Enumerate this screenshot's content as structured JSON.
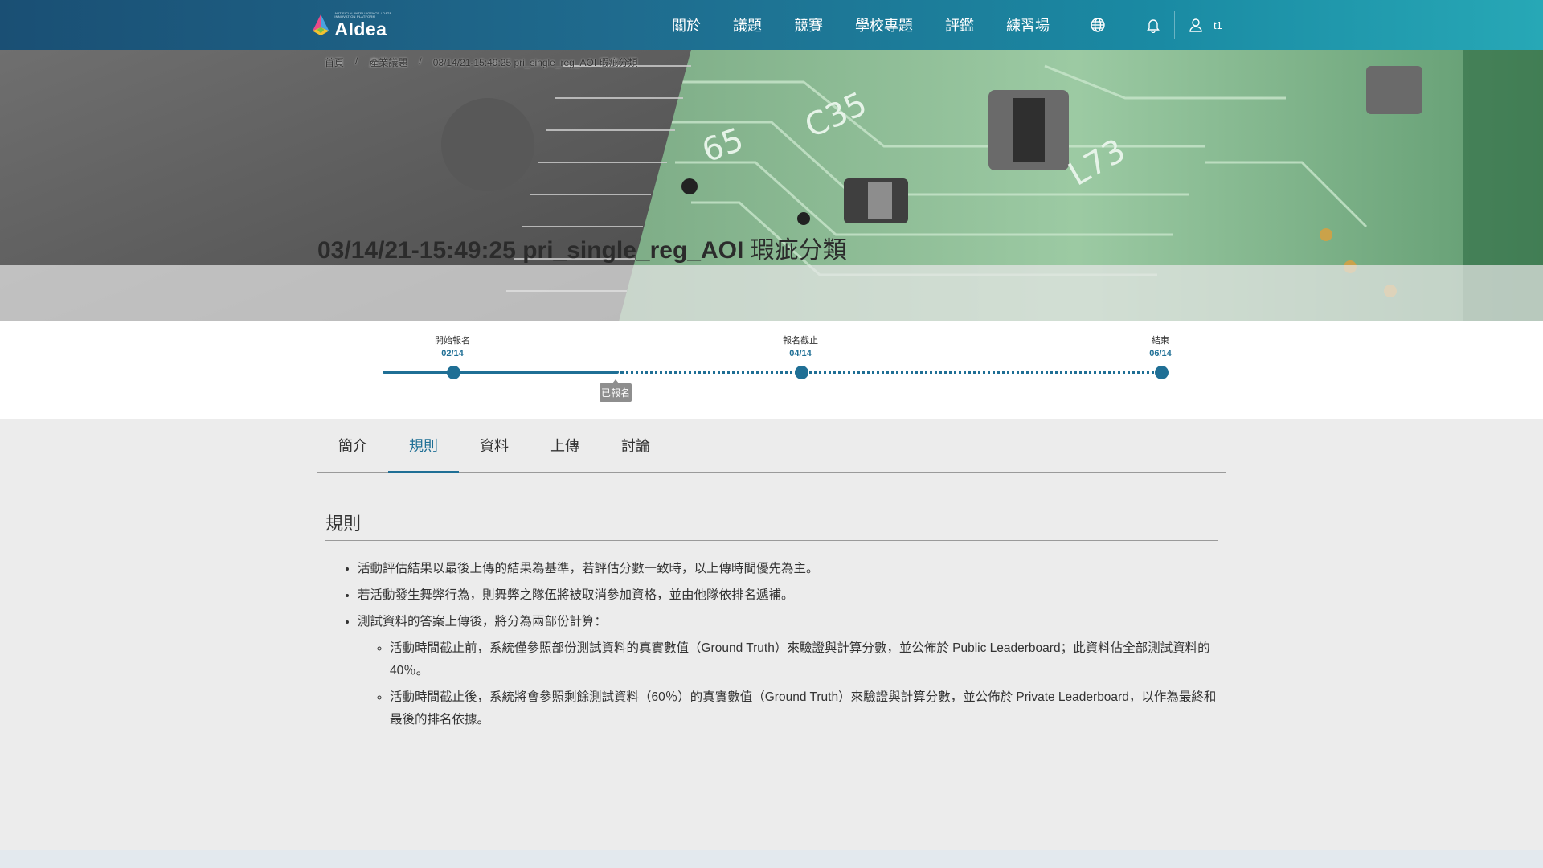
{
  "header": {
    "logo_tagline": "ARTIFICIAL INTELLIGENCE / DATA INNOVATION PLATFORM",
    "logo_text": "AIdea",
    "nav": [
      "關於",
      "議題",
      "競賽",
      "學校專題",
      "評鑑",
      "練習場"
    ],
    "icons": [
      "globe-icon",
      "bell-icon",
      "user-icon"
    ],
    "user_name": "t1",
    "colors": {
      "start": "#1a4f74",
      "end": "#27a8b6"
    }
  },
  "breadcrumb": [
    "首頁",
    "產業議題",
    "03/14/21-15:49:25 pri_single_reg_AOI 瑕疵分類"
  ],
  "page_title": {
    "bold": "03/14/21-15:49:25 pri_single_reg_AOI",
    "rest": " 瑕疵分類"
  },
  "timeline": {
    "milestones": [
      {
        "label": "開始報名",
        "date": "02/14"
      },
      {
        "label": "報名截止",
        "date": "04/14"
      },
      {
        "label": "結束",
        "date": "06/14"
      }
    ],
    "status_badge": "已報名",
    "accent": "#1f6f95"
  },
  "tabs": {
    "items": [
      "簡介",
      "規則",
      "資料",
      "上傳",
      "討論"
    ],
    "active": "規則"
  },
  "rules": {
    "title": "規則",
    "items": [
      "活動評估結果以最後上傳的結果為基準，若評估分數一致時，以上傳時間優先為主。",
      "若活動發生舞弊行為，則舞弊之隊伍將被取消參加資格，並由他隊依排名遞補。",
      "測試資料的答案上傳後，將分為兩部份計算："
    ],
    "sub_items": [
      "活動時間截止前，系統僅參照部份測試資料的真實數值（Ground Truth）來驗證與計算分數，並公佈於 Public Leaderboard；此資料佔全部測試資料的 40％。",
      "活動時間截止後，系統將會參照剩餘測試資料（60％）的真實數值（Ground Truth）來驗證與計算分數，並公佈於 Private Leaderboard，以作為最終和最後的排名依據。"
    ]
  }
}
